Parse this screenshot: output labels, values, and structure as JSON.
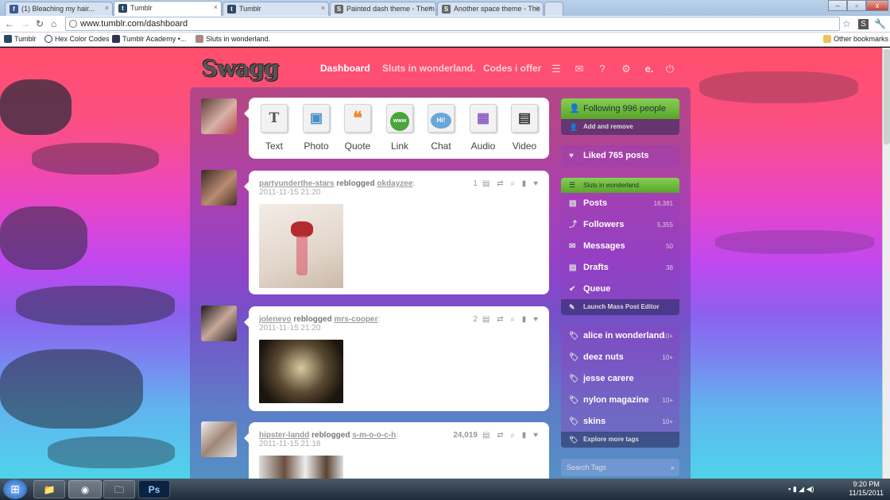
{
  "browser": {
    "tabs": [
      {
        "label": "(1) Bleaching my hair...",
        "icon": "facebook-icon",
        "color": "#3b5998"
      },
      {
        "label": "Tumblr",
        "icon": "tumblr-icon",
        "color": "#2c4762",
        "active": true
      },
      {
        "label": "Tumblr",
        "icon": "tumblr-icon",
        "color": "#2c4762"
      },
      {
        "label": "Painted dash theme - Them",
        "icon": "page-icon",
        "color": "#666666"
      },
      {
        "label": "Another space theme - The",
        "icon": "page-icon",
        "color": "#666666"
      }
    ],
    "url": "www.tumblr.com/dashboard",
    "bookmarks": [
      "Tumblr",
      "Hex Color Codes",
      "Tumblr Academy •...",
      "Sluts in wonderland."
    ],
    "other_bookmarks": "Other bookmarks"
  },
  "header": {
    "logo": "Swagg",
    "nav": [
      "Dashboard",
      "Sluts in wonderland.",
      "Codes i offer"
    ],
    "icons": [
      "list-icon",
      "mail-icon",
      "help-icon",
      "settings-icon",
      "edit-icon",
      "power-icon"
    ]
  },
  "composer": {
    "types": [
      {
        "label": "Text",
        "glyph": "T"
      },
      {
        "label": "Photo",
        "glyph": "▣"
      },
      {
        "label": "Quote",
        "glyph": "❝"
      },
      {
        "label": "Link",
        "glyph": "www"
      },
      {
        "label": "Chat",
        "glyph": "Hi!"
      },
      {
        "label": "Audio",
        "glyph": "▦"
      },
      {
        "label": "Video",
        "glyph": "▤"
      }
    ]
  },
  "posts": [
    {
      "user": "partyunderthe-stars",
      "action": "reblogged",
      "source": "okdayzee",
      "date": "2011-11-15 21:20",
      "notes": "1"
    },
    {
      "user": "joleneyo",
      "action": "reblogged",
      "source": "mrs-cooper",
      "date": "2011-11-15 21:20",
      "notes": "2"
    },
    {
      "user": "hipster-landd",
      "action": "reblogged",
      "source": "s-m-o-o-c-h",
      "date": "2011-11-15 21:18",
      "notes": "24,019"
    }
  ],
  "sidebar": {
    "following": "Following 996 people",
    "add_remove": "Add and remove",
    "liked": "Liked 765 posts",
    "blog": "Sluts in wonderland.",
    "stats": [
      {
        "label": "Posts",
        "count": "16,381"
      },
      {
        "label": "Followers",
        "count": "5,355"
      },
      {
        "label": "Messages",
        "count": "50"
      },
      {
        "label": "Drafts",
        "count": "38"
      },
      {
        "label": "Queue",
        "count": ""
      }
    ],
    "mass_editor": "Launch Mass Post Editor",
    "tags": [
      {
        "label": "alice in wonderland",
        "count": "10+"
      },
      {
        "label": "deez nuts",
        "count": "10+"
      },
      {
        "label": "jesse carere",
        "count": ""
      },
      {
        "label": "nylon magazine",
        "count": "10+"
      },
      {
        "label": "skins",
        "count": "10+"
      }
    ],
    "explore": "Explore more tags",
    "search_placeholder": "Search Tags"
  },
  "taskbar": {
    "time": "9:20 PM",
    "date": "11/15/2011",
    "ps": "Ps"
  }
}
